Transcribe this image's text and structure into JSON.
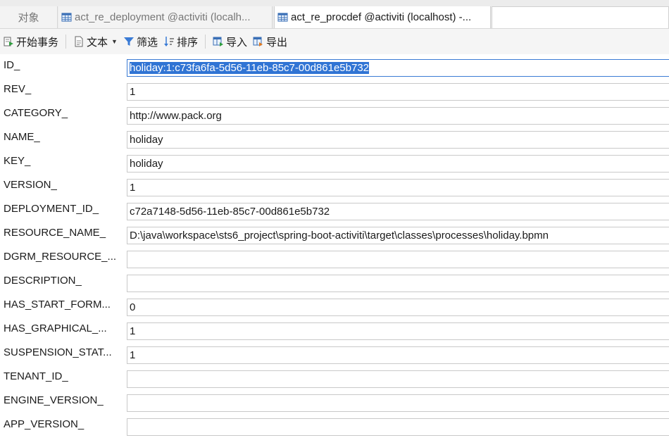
{
  "tabs": {
    "objects": "对象",
    "tab1": "act_re_deployment @activiti (localh...",
    "tab2": "act_re_procdef @activiti (localhost) -..."
  },
  "toolbar": {
    "begin_transaction": "开始事务",
    "text": "文本",
    "filter": "筛选",
    "sort": "排序",
    "import": "导入",
    "export": "导出"
  },
  "fields": [
    {
      "label": "ID_",
      "value": "holiday:1:c73fa6fa-5d56-11eb-85c7-00d861e5b732"
    },
    {
      "label": "REV_",
      "value": "1"
    },
    {
      "label": "CATEGORY_",
      "value": "http://www.pack.org"
    },
    {
      "label": "NAME_",
      "value": "holiday"
    },
    {
      "label": "KEY_",
      "value": "holiday"
    },
    {
      "label": "VERSION_",
      "value": "1"
    },
    {
      "label": "DEPLOYMENT_ID_",
      "value": "c72a7148-5d56-11eb-85c7-00d861e5b732"
    },
    {
      "label": "RESOURCE_NAME_",
      "value": "D:\\java\\workspace\\sts6_project\\spring-boot-activiti\\target\\classes\\processes\\holiday.bpmn"
    },
    {
      "label": "DGRM_RESOURCE_...",
      "value": ""
    },
    {
      "label": "DESCRIPTION_",
      "value": ""
    },
    {
      "label": "HAS_START_FORM...",
      "value": "0"
    },
    {
      "label": "HAS_GRAPHICAL_...",
      "value": "1"
    },
    {
      "label": "SUSPENSION_STAT...",
      "value": "1"
    },
    {
      "label": "TENANT_ID_",
      "value": ""
    },
    {
      "label": "ENGINE_VERSION_",
      "value": ""
    },
    {
      "label": "APP_VERSION_",
      "value": ""
    }
  ]
}
